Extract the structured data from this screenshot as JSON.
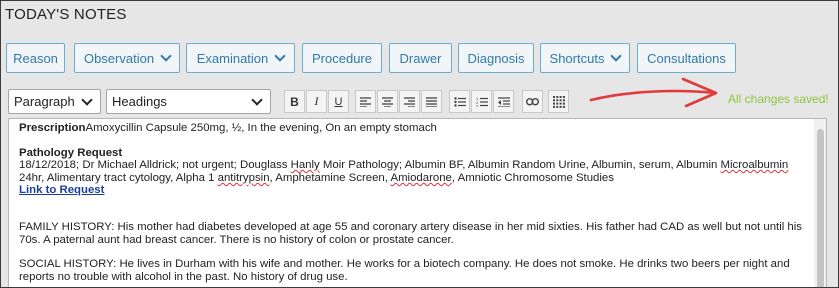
{
  "header": {
    "title": "TODAY'S NOTES"
  },
  "nav": {
    "reason": "Reason",
    "observation": "Observation",
    "examination": "Examination",
    "procedure": "Procedure",
    "drawer": "Drawer",
    "diagnosis": "Diagnosis",
    "shortcuts": "Shortcuts",
    "consultations": "Consultations"
  },
  "toolbar": {
    "paragraph_select": "Paragraph",
    "headings_select": "Headings",
    "bold": "B",
    "italic": "I",
    "underline": "U"
  },
  "status": {
    "saved_text": "All changes saved!",
    "color": "#8cc63f"
  },
  "annotation": {
    "arrow_color": "#e03a3a"
  },
  "note": {
    "prescription_label": "Prescription",
    "prescription_text": "Amoxycillin Capsule 250mg, ½, In the evening, On an empty stomach",
    "pathology_heading": "Pathology Request",
    "pathology_line1_a": "18/12/2018; Dr Michael Alldrick; not urgent; Douglass ",
    "pathology_hanly": "Hanly",
    "pathology_line1_b": " Moir Pathology; Albumin BF, Albumin Random Urine, Albumin, serum, Albumin ",
    "pathology_microalbumin": "Microalbumin",
    "pathology_line2_a": "24hr, Alimentary tract cytology, Alpha 1 ",
    "pathology_antitrypsin": "antitrypsin",
    "pathology_line2_b": ", Amphetamine Screen, ",
    "pathology_amiodarone": "Amiodarone",
    "pathology_line2_c": ", Amniotic Chromosome Studies",
    "link_text": "Link to Request",
    "family_history": "FAMILY HISTORY: His mother had diabetes developed at age 55 and coronary artery disease in her mid sixties. His father had CAD as well but not until his 70s. A paternal aunt had breast cancer. There is no history of colon or prostate cancer.",
    "social_history": "SOCIAL HISTORY: He lives in Durham with his wife and mother. He works for a biotech company. He does not smoke. He drinks two beers per night and reports no trouble with alcohol in the past. No history of drug use."
  }
}
